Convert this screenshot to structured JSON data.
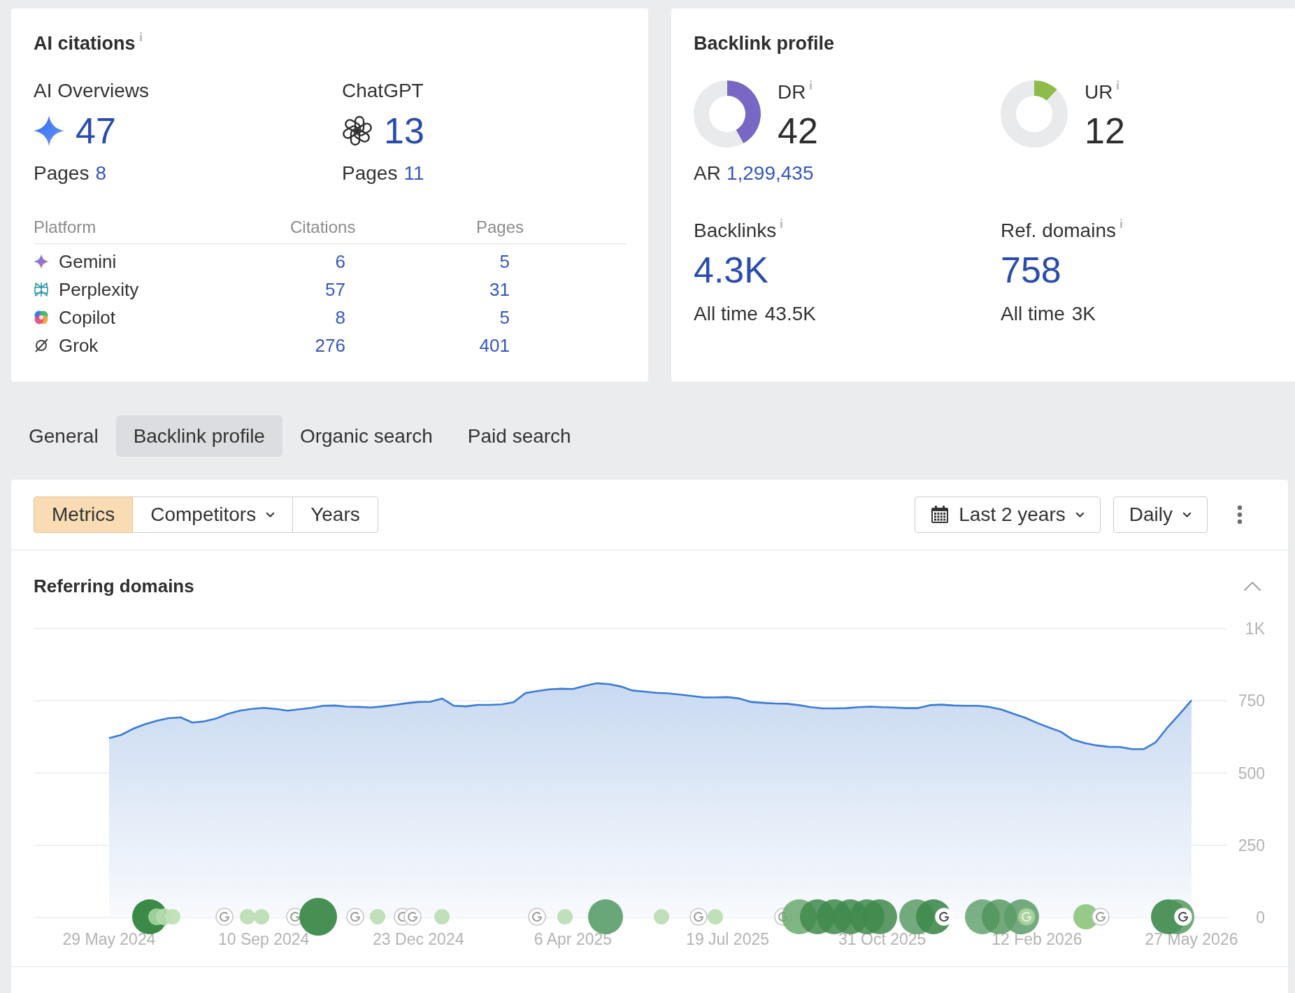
{
  "ai_citations": {
    "title": "AI citations",
    "engines": [
      {
        "name": "AI Overviews",
        "count": "47",
        "pages_label": "Pages",
        "pages": "8"
      },
      {
        "name": "ChatGPT",
        "count": "13",
        "pages_label": "Pages",
        "pages": "11"
      }
    ],
    "table": {
      "columns": [
        "Platform",
        "Citations",
        "Pages"
      ],
      "rows": [
        {
          "platform": "Gemini",
          "citations": "6",
          "pages": "5"
        },
        {
          "platform": "Perplexity",
          "citations": "57",
          "pages": "31"
        },
        {
          "platform": "Copilot",
          "citations": "8",
          "pages": "5"
        },
        {
          "platform": "Grok",
          "citations": "276",
          "pages": "401"
        }
      ]
    }
  },
  "backlink_profile": {
    "title": "Backlink profile",
    "ratings": [
      {
        "label": "DR",
        "value": "42",
        "color": "#7867c4",
        "chart_data": {
          "type": "donut",
          "values": [
            42,
            58
          ]
        },
        "rank": {
          "label": "AR",
          "value": "1,299,435"
        }
      },
      {
        "label": "UR",
        "value": "12",
        "color": "#8fbb4b",
        "chart_data": {
          "type": "donut",
          "values": [
            12,
            88
          ]
        }
      }
    ],
    "stats": [
      {
        "label": "Backlinks",
        "value": "4.3K",
        "all_time_label": "All time",
        "all_time": "43.5K"
      },
      {
        "label": "Ref. domains",
        "value": "758",
        "all_time_label": "All time",
        "all_time": "3K"
      }
    ]
  },
  "tabs": [
    {
      "label": "General",
      "selected": false
    },
    {
      "label": "Backlink profile",
      "selected": true
    },
    {
      "label": "Organic search",
      "selected": false
    },
    {
      "label": "Paid search",
      "selected": false
    }
  ],
  "toolbar": {
    "views": [
      {
        "label": "Metrics",
        "selected": true,
        "dropdown": false
      },
      {
        "label": "Competitors",
        "selected": false,
        "dropdown": true
      },
      {
        "label": "Years",
        "selected": false,
        "dropdown": false
      }
    ],
    "date_range": "Last 2 years",
    "interval": "Daily"
  },
  "referring_domains": {
    "title": "Referring domains",
    "expanded": true,
    "chart_data": {
      "type": "area",
      "categories": [
        "29 May 2024",
        null,
        null,
        null,
        null,
        null,
        null,
        null,
        null,
        null,
        null,
        null,
        null,
        "10 Sep 2024",
        null,
        null,
        null,
        null,
        null,
        null,
        null,
        null,
        null,
        null,
        null,
        null,
        "23 Dec 2024",
        null,
        null,
        null,
        null,
        null,
        null,
        null,
        null,
        null,
        null,
        null,
        null,
        "6 Apr 2025",
        null,
        null,
        null,
        null,
        null,
        null,
        null,
        null,
        null,
        null,
        null,
        null,
        "19 Jul 2025",
        null,
        null,
        null,
        null,
        null,
        null,
        null,
        null,
        null,
        null,
        null,
        null,
        "31 Oct 2025",
        null,
        null,
        null,
        null,
        null,
        null,
        null,
        null,
        null,
        null,
        null,
        null,
        "12 Feb 2026",
        null,
        null,
        null,
        null,
        null,
        null,
        null,
        null,
        null,
        null,
        null,
        null,
        "27 May 2026"
      ],
      "values": [
        621,
        632,
        653,
        669,
        681,
        690,
        693,
        675,
        679,
        689,
        705,
        716,
        722,
        726,
        722,
        716,
        721,
        726,
        733,
        734,
        730,
        729,
        727,
        731,
        736,
        742,
        746,
        747,
        758,
        733,
        731,
        736,
        736,
        738,
        745,
        777,
        784,
        790,
        792,
        791,
        802,
        811,
        808,
        800,
        786,
        782,
        778,
        776,
        772,
        767,
        762,
        762,
        763,
        758,
        746,
        743,
        741,
        740,
        735,
        728,
        724,
        724,
        725,
        728,
        730,
        728,
        727,
        725,
        725,
        735,
        737,
        734,
        733,
        733,
        729,
        720,
        706,
        692,
        674,
        658,
        643,
        616,
        604,
        596,
        591,
        590,
        583,
        583,
        607,
        659,
        704,
        752
      ],
      "ylim": [
        0,
        1000
      ],
      "yticks": [
        {
          "value": 0,
          "label": "0"
        },
        {
          "value": 250,
          "label": "250"
        },
        {
          "value": 500,
          "label": "500"
        },
        {
          "value": 750,
          "label": "750"
        },
        {
          "value": 1000,
          "label": "1K"
        }
      ],
      "grid": true
    }
  }
}
